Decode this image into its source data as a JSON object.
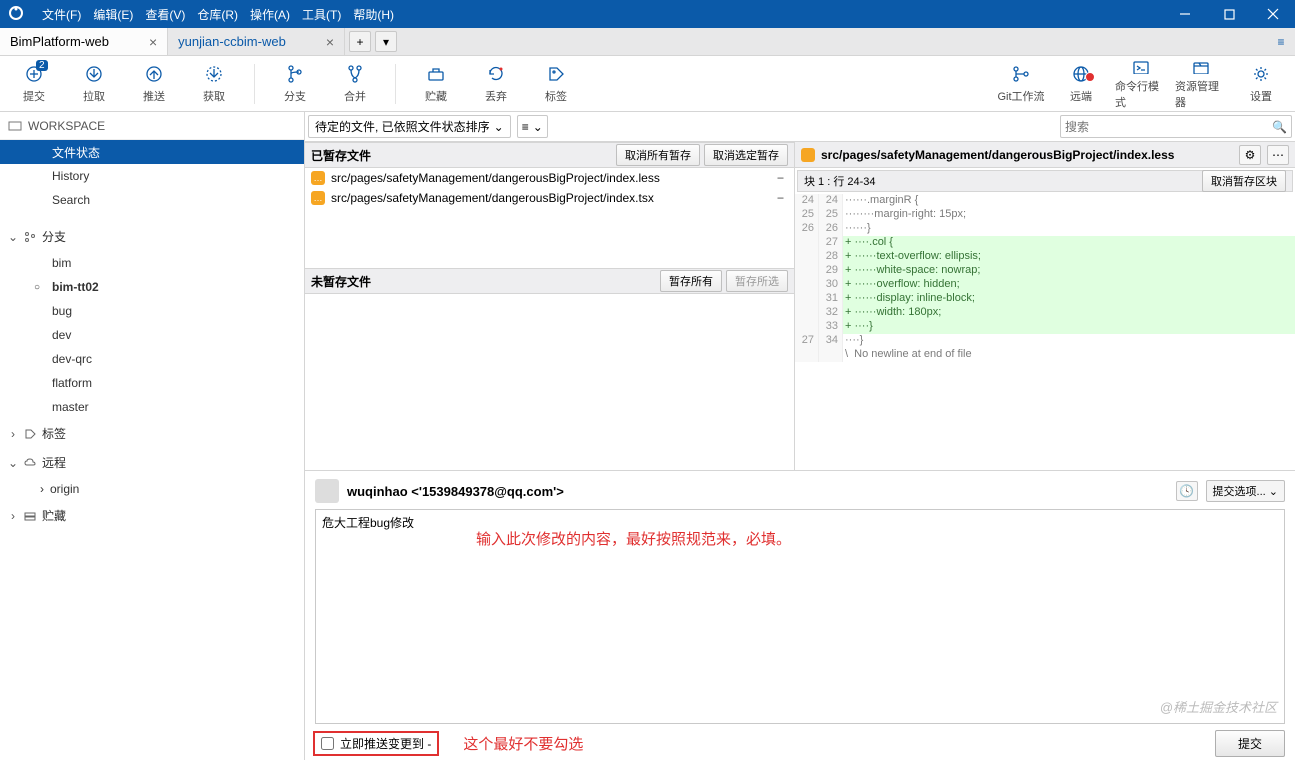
{
  "menu": {
    "file": "文件(F)",
    "edit": "编辑(E)",
    "view": "查看(V)",
    "repo": "仓库(R)",
    "action": "操作(A)",
    "tools": "工具(T)",
    "help": "帮助(H)"
  },
  "tabs": {
    "active": "BimPlatform-web",
    "inactive": "yunjian-ccbim-web"
  },
  "toolbar": {
    "commit": "提交",
    "commit_badge": "2",
    "pull": "拉取",
    "push": "推送",
    "fetch": "获取",
    "branch": "分支",
    "merge": "合并",
    "stash": "贮藏",
    "discard": "丢弃",
    "tag": "标签",
    "gitflow": "Git工作流",
    "remote": "远端",
    "terminal": "命令行模式",
    "explorer": "资源管理器",
    "settings": "设置"
  },
  "sidebar": {
    "workspace": "WORKSPACE",
    "ws_items": {
      "status": "文件状态",
      "history": "History",
      "search": "Search"
    },
    "branch_sect": "分支",
    "branches": [
      "bim",
      "bim-tt02",
      "bug",
      "dev",
      "dev-qrc",
      "flatform",
      "master"
    ],
    "tags_sect": "标签",
    "remote_sect": "远程",
    "remotes": [
      "origin"
    ],
    "stash_sect": "贮藏"
  },
  "filter": {
    "pending": "待定的文件, 已依照文件状态排序",
    "search_ph": "搜索"
  },
  "staged": {
    "header": "已暂存文件",
    "unstage_all": "取消所有暂存",
    "unstage_sel": "取消选定暂存",
    "files": [
      "src/pages/safetyManagement/dangerousBigProject/index.less",
      "src/pages/safetyManagement/dangerousBigProject/index.tsx"
    ]
  },
  "unstaged": {
    "header": "未暂存文件",
    "stage_all": "暂存所有",
    "stage_sel": "暂存所选"
  },
  "diff": {
    "path": "src/pages/safetyManagement/dangerousBigProject/index.less",
    "hunk": "块 1 : 行 24-34",
    "unstage_hunk": "取消暂存区块",
    "lines": [
      {
        "a": "24",
        "b": "24",
        "m": "",
        "t": "······.marginR {"
      },
      {
        "a": "25",
        "b": "25",
        "m": "",
        "t": "········margin-right: 15px;"
      },
      {
        "a": "26",
        "b": "26",
        "m": "",
        "t": "······}"
      },
      {
        "a": "",
        "b": "27",
        "m": "+",
        "t": "+ ····.col {"
      },
      {
        "a": "",
        "b": "28",
        "m": "+",
        "t": "+ ······text-overflow: ellipsis;"
      },
      {
        "a": "",
        "b": "29",
        "m": "+",
        "t": "+ ······white-space: nowrap;"
      },
      {
        "a": "",
        "b": "30",
        "m": "+",
        "t": "+ ······overflow: hidden;"
      },
      {
        "a": "",
        "b": "31",
        "m": "+",
        "t": "+ ······display: inline-block;"
      },
      {
        "a": "",
        "b": "32",
        "m": "+",
        "t": "+ ······width: 180px;"
      },
      {
        "a": "",
        "b": "33",
        "m": "+",
        "t": "+ ····}"
      },
      {
        "a": "27",
        "b": "34",
        "m": "",
        "t": "····}"
      },
      {
        "a": "",
        "b": "",
        "m": "",
        "t": "\\  No newline at end of file"
      }
    ]
  },
  "commit": {
    "user": "wuqinhao <'1539849378@qq.com'>",
    "options": "提交选项...",
    "message": "危大工程bug修改",
    "annotation1": "输入此次修改的内容，最好按照规范来，必填。",
    "push_label": "立即推送变更到 -",
    "annotation2": "这个最好不要勾选",
    "button": "提交"
  },
  "watermark": "@稀土掘金技术社区"
}
